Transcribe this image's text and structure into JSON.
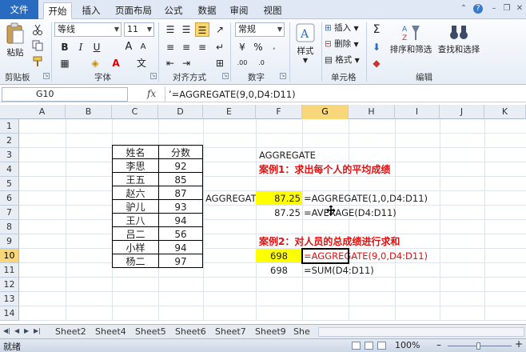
{
  "ribbon": {
    "tabs": [
      "文件",
      "开始",
      "插入",
      "页面布局",
      "公式",
      "数据",
      "审阅",
      "视图"
    ],
    "active_tab": "开始",
    "paste_label": "粘贴",
    "font_name": "等线",
    "font_size": "11",
    "number_format": "常规",
    "style_label": "样式",
    "insert_label": "插入",
    "delete_label": "删除",
    "format_label": "格式",
    "sort_filter_label": "排序和筛选",
    "find_select_label": "查找和选择",
    "groups": {
      "clipboard": "剪贴板",
      "font": "字体",
      "alignment": "对齐方式",
      "number": "数字",
      "cells": "单元格",
      "editing": "编辑"
    }
  },
  "formula_bar": {
    "name_box": "G10",
    "fx": "fx",
    "formula": "’=AGGREGATE(9,0,D4:D11)"
  },
  "grid": {
    "columns": [
      "A",
      "B",
      "C",
      "D",
      "E",
      "F",
      "G",
      "H",
      "I",
      "J",
      "K"
    ],
    "rows": [
      "1",
      "2",
      "3",
      "4",
      "5",
      "6",
      "7",
      "8",
      "9",
      "10",
      "11",
      "12",
      "13",
      "14"
    ],
    "selected_cell": "G10",
    "table": {
      "headers": [
        "姓名",
        "分数"
      ],
      "rows": [
        [
          "李思",
          "92"
        ],
        [
          "王五",
          "85"
        ],
        [
          "赵六",
          "87"
        ],
        [
          "驴儿",
          "93"
        ],
        [
          "王八",
          "94"
        ],
        [
          "吕二",
          "56"
        ],
        [
          "小样",
          "94"
        ],
        [
          "杨二",
          "97"
        ]
      ]
    },
    "cells": {
      "F3": "AGGREGATE",
      "F4": "案例1：求出每个人的平均成绩",
      "E6": "AGGREGATE",
      "F6": "87.25",
      "G6": "=AGGREGATE(1,0,D4:D11)",
      "F7": "87.25",
      "G7": "=AVERAGE(D4:D11)",
      "F9": "案例2：对人员的总成绩进行求和",
      "F10": "698",
      "G10": "=AGGREGATE(9,0,D4:D11)",
      "F11": "698",
      "G11": "=SUM(D4:D11)"
    }
  },
  "sheet_tabs": [
    "Sheet2",
    "Sheet4",
    "Sheet5",
    "Sheet6",
    "Sheet7",
    "Sheet9",
    "She"
  ],
  "status": {
    "mode": "就绪",
    "zoom": "100%"
  },
  "colors": {
    "accent": "#2a6bc2",
    "highlight": "#ffff00",
    "red_text": "#e01010",
    "selected_header": "#f7d77a"
  }
}
